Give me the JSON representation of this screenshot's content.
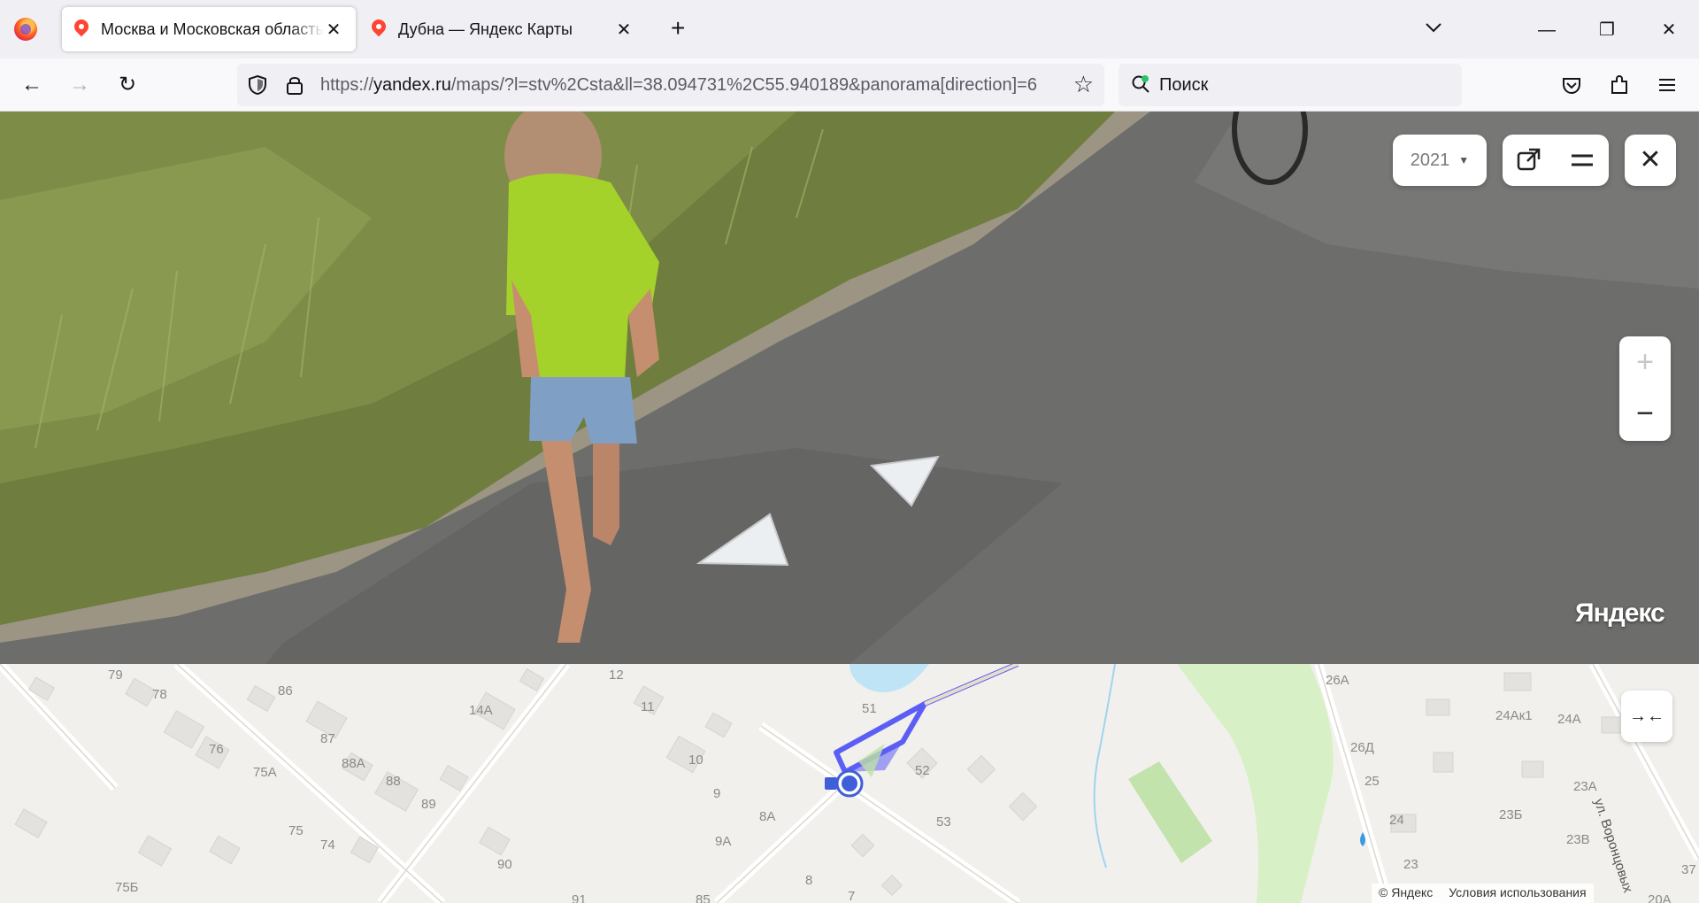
{
  "browser": {
    "tabs": [
      {
        "title": "Москва и Московская область",
        "active": true
      },
      {
        "title": "Дубна — Яндекс Карты",
        "active": false
      }
    ],
    "new_tab_label": "+",
    "url_prefix": "https://",
    "url_host": "yandex.ru",
    "url_rest": "/maps/?l=stv%2Csta&ll=38.094731%2C55.940189&panorama[direction]=6",
    "search_placeholder": "Поиск",
    "window_buttons": {
      "minimize": "—",
      "restore": "❐",
      "close": "✕"
    }
  },
  "panorama": {
    "year": "2021",
    "watermark": "Яндекс",
    "zoom_in": "+",
    "zoom_out": "−",
    "close": "✕"
  },
  "minimap": {
    "collapse_label": "→←",
    "copyright": "© Яндекс",
    "terms": "Условия использования",
    "street_label": "ул. Воронцовых",
    "house_labels": [
      "79",
      "78",
      "86",
      "12",
      "11",
      "51",
      "26А",
      "24Ак1",
      "24А",
      "14А",
      "87",
      "76",
      "75А",
      "88А",
      "88",
      "89",
      "10",
      "9",
      "52",
      "26Д",
      "25",
      "23А",
      "8А",
      "9А",
      "75",
      "74",
      "53",
      "24",
      "23Б",
      "23В",
      "90",
      "8",
      "23",
      "75Б",
      "91",
      "85",
      "7",
      "37",
      "20А"
    ]
  },
  "colors": {
    "route": "#5b5ef5",
    "position_dot": "#3f5fd8",
    "park": "#d7f0c5",
    "water": "#bfe4f6"
  }
}
